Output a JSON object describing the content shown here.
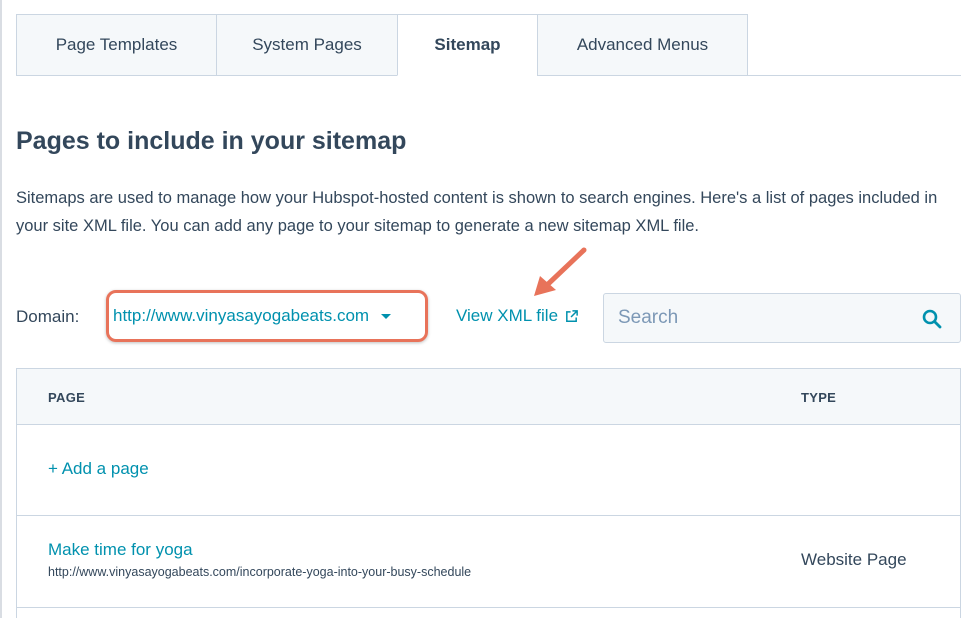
{
  "tabs": [
    {
      "label": "Page Templates",
      "active": false
    },
    {
      "label": "System Pages",
      "active": false
    },
    {
      "label": "Sitemap",
      "active": true
    },
    {
      "label": "Advanced Menus",
      "active": false
    }
  ],
  "heading": "Pages to include in your sitemap",
  "description": "Sitemaps are used to manage how your Hubspot-hosted content is shown to search engines. Here's a list of pages included in your site XML file. You can add any page to your sitemap to generate a new sitemap XML file.",
  "domain": {
    "label": "Domain:",
    "selected": "http://www.vinyasayogabeats.com"
  },
  "xml_link": {
    "label": "View XML file",
    "icon": "external-link-icon"
  },
  "search": {
    "placeholder": "Search",
    "value": "",
    "icon": "search-icon"
  },
  "table": {
    "columns": [
      "PAGE",
      "TYPE"
    ],
    "add_label": "+ Add a page",
    "rows": [
      {
        "name": "Make time for yoga",
        "url": "http://www.vinyasayogabeats.com/incorporate-yoga-into-your-busy-schedule",
        "type": "Website Page"
      }
    ]
  },
  "colors": {
    "link": "#0091ae",
    "text": "#33475b",
    "highlight": "#e8735a",
    "border": "#cbd6e2",
    "panel": "#f5f8fa"
  }
}
